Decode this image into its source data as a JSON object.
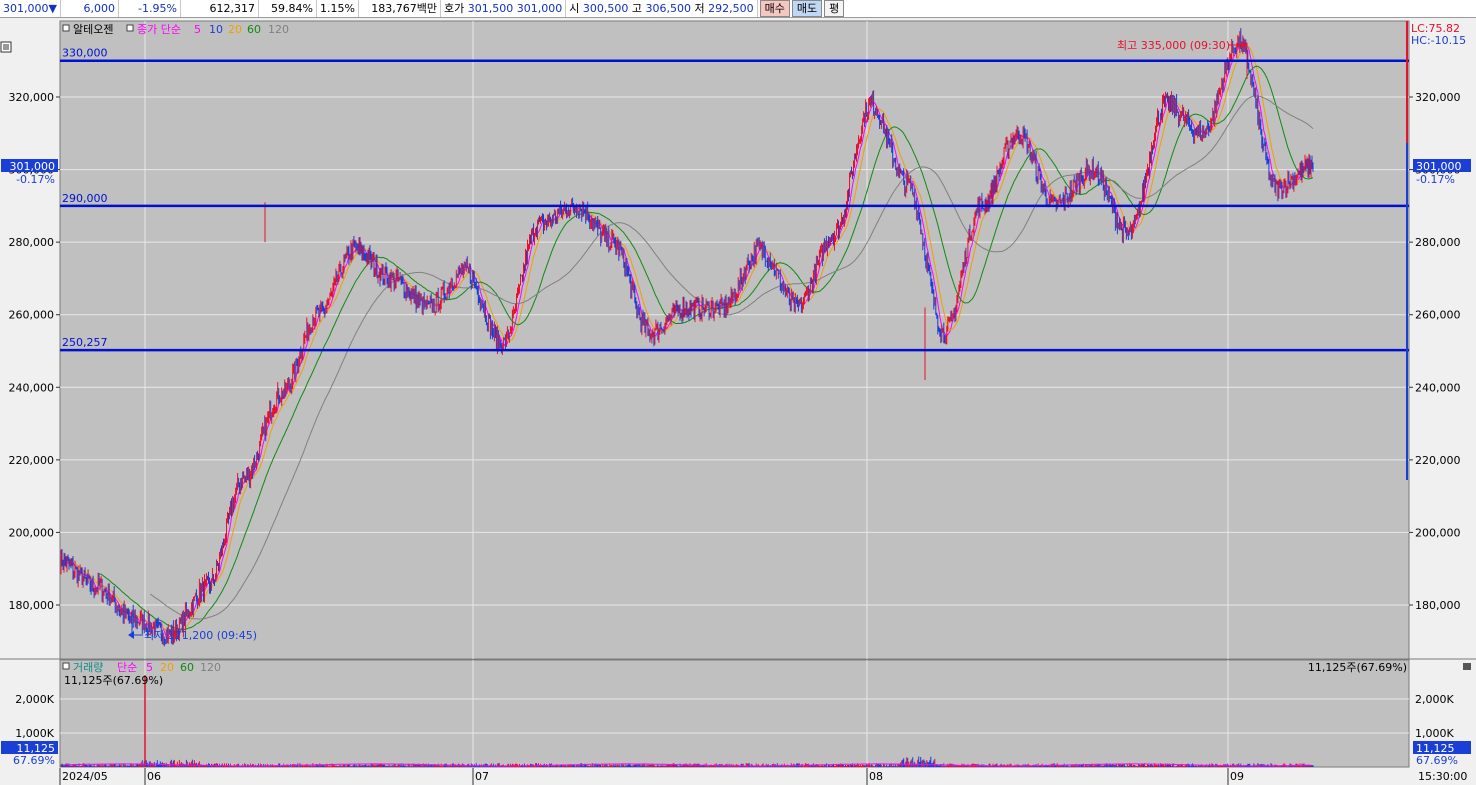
{
  "topbar": {
    "price": "301,000",
    "arrow": "▼",
    "change": "6,000",
    "change_pct": "-1.95%",
    "volume": "612,317",
    "vol_ratio": "59.84%",
    "turnover_rate": "1.15%",
    "amount": "183,767백만",
    "quote_label": "호가",
    "ask": "301,500",
    "bid": "301,000",
    "open_label": "시",
    "open": "300,500",
    "high_label": "고",
    "high": "306,500",
    "low_label": "저",
    "low": "292,500",
    "buy_label": "매수",
    "sell_label": "매도",
    "avg_label": "평"
  },
  "price_panel": {
    "stock_name": "알테오젠",
    "ma_type": "종가 단순",
    "ma_labels": [
      "5",
      "10",
      "20",
      "60",
      "120"
    ],
    "lc_text": "LC:75.82",
    "hc_text": "HC:-10.15",
    "current_tag": "301,000",
    "current_pct": "-0.17%",
    "high_annotation": "최고 335,000 (09:30)",
    "low_annotation": "최저 171,200 (09:45)",
    "levels": [
      {
        "value": 330000,
        "label": "330,000"
      },
      {
        "value": 290000,
        "label": "290,000"
      },
      {
        "value": 250257,
        "label": "250,257"
      }
    ],
    "y_ticks": [
      "320,000",
      "300,000",
      "280,000",
      "260,000",
      "240,000",
      "220,000",
      "200,000",
      "180,000"
    ]
  },
  "volume_panel": {
    "title": "거래량",
    "ma_type": "단순",
    "ma_labels": [
      "5",
      "20",
      "60",
      "120"
    ],
    "info_left": "11,125주(67.69%)",
    "info_right": "11,125주(67.69%)",
    "current_tag": "11,125",
    "current_pct": "67.69%",
    "y_ticks": [
      "2,000K",
      "1,000K"
    ]
  },
  "x_axis": {
    "labels": [
      "2024/05",
      "06",
      "07",
      "08",
      "09"
    ],
    "time": "15:30:00"
  },
  "colors": {
    "up": "#e8102a",
    "down": "#1a3fd6",
    "ma5": "#ff00ff",
    "ma10": "#1a3fd6",
    "ma20": "#f0a000",
    "ma60": "#108a10",
    "ma120": "#808080",
    "level_line": "#0010d0",
    "plot_bg": "#c0c0c0"
  },
  "chart_data": {
    "type": "line",
    "title": "알테오젠",
    "x": [
      "2024/05",
      "06",
      "07",
      "08",
      "09"
    ],
    "ylim": [
      165000,
      340000
    ],
    "grid": true,
    "series": [
      {
        "name": "종가",
        "values": [
          [
            "2024/05",
            192000
          ],
          [
            "2024/05",
            185000
          ],
          [
            "2024/05",
            176000
          ],
          [
            "06",
            172000
          ],
          [
            "06",
            185000
          ],
          [
            "06",
            215000
          ],
          [
            "06",
            238000
          ],
          [
            "06",
            260000
          ],
          [
            "06",
            278000
          ],
          [
            "06",
            270000
          ],
          [
            "06",
            262000
          ],
          [
            "06",
            272000
          ],
          [
            "06",
            252000
          ],
          [
            "07",
            285000
          ],
          [
            "07",
            290000
          ],
          [
            "07",
            280000
          ],
          [
            "07",
            255000
          ],
          [
            "07",
            262000
          ],
          [
            "07",
            262000
          ],
          [
            "07",
            278000
          ],
          [
            "07",
            262000
          ],
          [
            "07",
            282000
          ],
          [
            "08",
            318000
          ],
          [
            "08",
            296000
          ],
          [
            "08",
            255000
          ],
          [
            "08",
            290000
          ],
          [
            "08",
            310000
          ],
          [
            "08",
            290000
          ],
          [
            "08",
            300000
          ],
          [
            "08",
            282000
          ],
          [
            "09",
            318000
          ],
          [
            "09",
            310000
          ],
          [
            "09",
            335000
          ],
          [
            "09",
            295000
          ],
          [
            "09",
            301000
          ]
        ]
      }
    ],
    "annotations": [
      {
        "text": "최고 335,000 (09:30)",
        "value": 335000
      },
      {
        "text": "최저 171,200 (09:45)",
        "value": 171200
      }
    ],
    "volume_ylim": [
      0,
      2500000
    ]
  }
}
